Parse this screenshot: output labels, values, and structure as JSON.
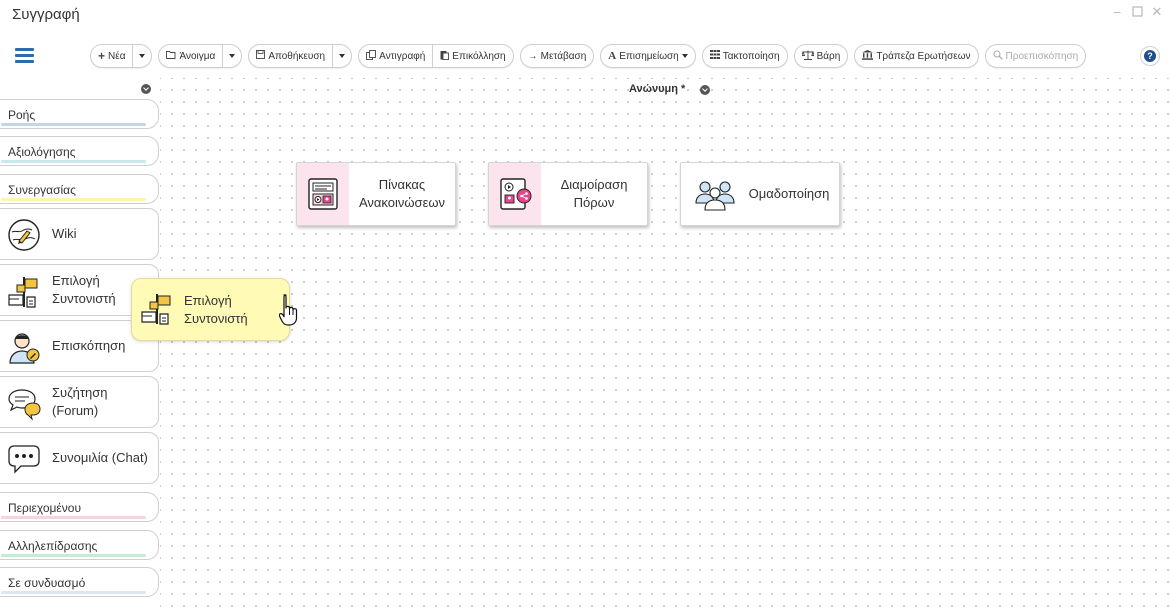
{
  "window": {
    "title": "Συγγραφή"
  },
  "toolbar": {
    "new_label": "Νέα",
    "open_label": "Άνοιγμα",
    "save_label": "Αποθήκευση",
    "copy_label": "Αντιγραφή",
    "paste_label": "Επικόλληση",
    "goto_label": "Μετάβαση",
    "annotate_label": "Επισημείωση",
    "arrange_label": "Τακτοποίηση",
    "weights_label": "Βάρη",
    "question_bank_label": "Τράπεζα Ερωτήσεων",
    "preview_label": "Προεπισκόπηση"
  },
  "canvas": {
    "title": "Ανώνυμη *"
  },
  "sidebar": {
    "categories": [
      {
        "label": "Ροής",
        "color": "#c5d3ec"
      },
      {
        "label": "Αξιολόγησης",
        "color": "#c9e7ec"
      },
      {
        "label": "Συνεργασίας",
        "color": "#fdf5b0"
      },
      {
        "label": "Περιεχομένου",
        "color": "#f9d3df"
      },
      {
        "label": "Αλληλεπίδρασης",
        "color": "#c5ebd6"
      },
      {
        "label": "Σε συνδυασμό",
        "color": "#dbe6f2"
      }
    ],
    "items": [
      {
        "label": "Wiki",
        "icon": "wiki-icon"
      },
      {
        "label": "Επιλογή Συντονιστή",
        "icon": "leader-selection-icon"
      },
      {
        "label": "Επισκόπηση",
        "icon": "peer-review-icon"
      },
      {
        "label": "Συζήτηση (Forum)",
        "icon": "forum-icon"
      },
      {
        "label": "Συνομιλία (Chat)",
        "icon": "chat-icon"
      }
    ]
  },
  "nodes": [
    {
      "label": "Πίνακας Ανακοινώσεων",
      "icon": "noticeboard-icon"
    },
    {
      "label": "Διαμοίραση Πόρων",
      "icon": "share-resources-icon"
    },
    {
      "label": "Ομαδοποίηση",
      "icon": "grouping-icon"
    }
  ],
  "dragging": {
    "label": "Επιλογή Συντονιστή",
    "icon": "leader-selection-icon"
  },
  "colors": {
    "accent": "#2b6cb0",
    "content_strip": "#fce4ee",
    "drag_bg": "#fffbb7"
  }
}
